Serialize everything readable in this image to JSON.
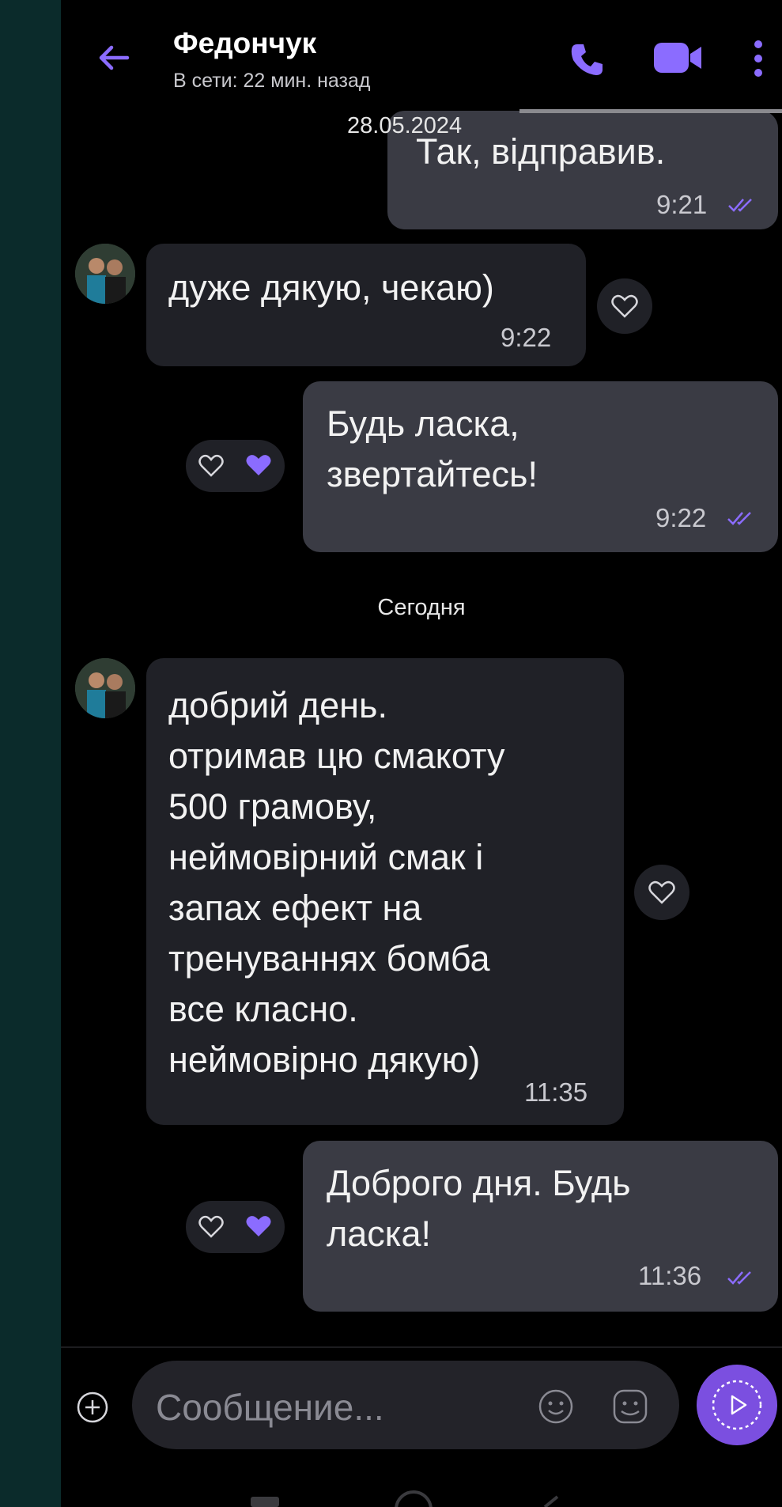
{
  "header": {
    "contact_name": "Федончук",
    "status": "В сети: 22 мин. назад",
    "icons": [
      "back-arrow-icon",
      "phone-icon",
      "video-camera-icon",
      "more-vertical-icon"
    ],
    "accent_color": "#7b5cff"
  },
  "date_chip": "28.05.2024",
  "messages": [
    {
      "direction": "out",
      "text": "Так, відправив.",
      "time": "9:21",
      "read": true
    },
    {
      "direction": "in",
      "text": "дуже дякую, чекаю)",
      "time": "9:22"
    },
    {
      "direction": "out",
      "text": "Будь ласка,\nзвертайтесь!",
      "time": "9:22",
      "read": true,
      "reaction": "liked"
    },
    {
      "direction": "in",
      "text": "добрий день.\nотримав  цю смакоту\n500 грамову,\nнеймовірний смак і\nзапах ефект на\nтренуваннях бомба\nвсе класно.\nнеймовірно дякую)",
      "time": "11:35"
    },
    {
      "direction": "out",
      "text": "Доброго дня. Будь\nласка!",
      "time": "11:36",
      "read": true,
      "reaction": "liked"
    }
  ],
  "day_separator": "Сегодня",
  "composer": {
    "placeholder": "Сообщение...",
    "icons": [
      "plus-icon",
      "emoji-icon",
      "sticker-icon",
      "send-icon"
    ]
  }
}
